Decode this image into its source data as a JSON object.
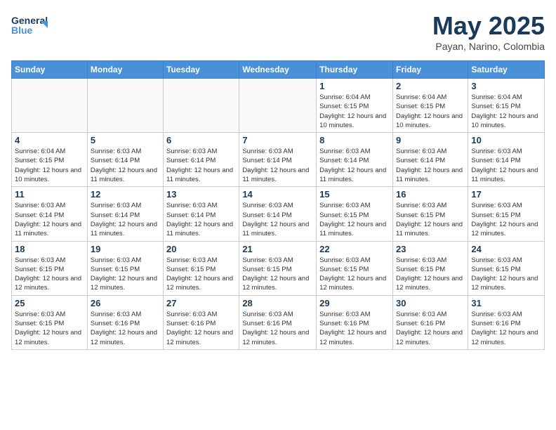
{
  "header": {
    "logo_general": "General",
    "logo_blue": "Blue",
    "month_year": "May 2025",
    "location": "Payan, Narino, Colombia"
  },
  "weekdays": [
    "Sunday",
    "Monday",
    "Tuesday",
    "Wednesday",
    "Thursday",
    "Friday",
    "Saturday"
  ],
  "weeks": [
    [
      {
        "day": "",
        "info": ""
      },
      {
        "day": "",
        "info": ""
      },
      {
        "day": "",
        "info": ""
      },
      {
        "day": "",
        "info": ""
      },
      {
        "day": "1",
        "info": "Sunrise: 6:04 AM\nSunset: 6:15 PM\nDaylight: 12 hours\nand 10 minutes."
      },
      {
        "day": "2",
        "info": "Sunrise: 6:04 AM\nSunset: 6:15 PM\nDaylight: 12 hours\nand 10 minutes."
      },
      {
        "day": "3",
        "info": "Sunrise: 6:04 AM\nSunset: 6:15 PM\nDaylight: 12 hours\nand 10 minutes."
      }
    ],
    [
      {
        "day": "4",
        "info": "Sunrise: 6:04 AM\nSunset: 6:15 PM\nDaylight: 12 hours\nand 10 minutes."
      },
      {
        "day": "5",
        "info": "Sunrise: 6:03 AM\nSunset: 6:14 PM\nDaylight: 12 hours\nand 11 minutes."
      },
      {
        "day": "6",
        "info": "Sunrise: 6:03 AM\nSunset: 6:14 PM\nDaylight: 12 hours\nand 11 minutes."
      },
      {
        "day": "7",
        "info": "Sunrise: 6:03 AM\nSunset: 6:14 PM\nDaylight: 12 hours\nand 11 minutes."
      },
      {
        "day": "8",
        "info": "Sunrise: 6:03 AM\nSunset: 6:14 PM\nDaylight: 12 hours\nand 11 minutes."
      },
      {
        "day": "9",
        "info": "Sunrise: 6:03 AM\nSunset: 6:14 PM\nDaylight: 12 hours\nand 11 minutes."
      },
      {
        "day": "10",
        "info": "Sunrise: 6:03 AM\nSunset: 6:14 PM\nDaylight: 12 hours\nand 11 minutes."
      }
    ],
    [
      {
        "day": "11",
        "info": "Sunrise: 6:03 AM\nSunset: 6:14 PM\nDaylight: 12 hours\nand 11 minutes."
      },
      {
        "day": "12",
        "info": "Sunrise: 6:03 AM\nSunset: 6:14 PM\nDaylight: 12 hours\nand 11 minutes."
      },
      {
        "day": "13",
        "info": "Sunrise: 6:03 AM\nSunset: 6:14 PM\nDaylight: 12 hours\nand 11 minutes."
      },
      {
        "day": "14",
        "info": "Sunrise: 6:03 AM\nSunset: 6:14 PM\nDaylight: 12 hours\nand 11 minutes."
      },
      {
        "day": "15",
        "info": "Sunrise: 6:03 AM\nSunset: 6:15 PM\nDaylight: 12 hours\nand 11 minutes."
      },
      {
        "day": "16",
        "info": "Sunrise: 6:03 AM\nSunset: 6:15 PM\nDaylight: 12 hours\nand 11 minutes."
      },
      {
        "day": "17",
        "info": "Sunrise: 6:03 AM\nSunset: 6:15 PM\nDaylight: 12 hours\nand 12 minutes."
      }
    ],
    [
      {
        "day": "18",
        "info": "Sunrise: 6:03 AM\nSunset: 6:15 PM\nDaylight: 12 hours\nand 12 minutes."
      },
      {
        "day": "19",
        "info": "Sunrise: 6:03 AM\nSunset: 6:15 PM\nDaylight: 12 hours\nand 12 minutes."
      },
      {
        "day": "20",
        "info": "Sunrise: 6:03 AM\nSunset: 6:15 PM\nDaylight: 12 hours\nand 12 minutes."
      },
      {
        "day": "21",
        "info": "Sunrise: 6:03 AM\nSunset: 6:15 PM\nDaylight: 12 hours\nand 12 minutes."
      },
      {
        "day": "22",
        "info": "Sunrise: 6:03 AM\nSunset: 6:15 PM\nDaylight: 12 hours\nand 12 minutes."
      },
      {
        "day": "23",
        "info": "Sunrise: 6:03 AM\nSunset: 6:15 PM\nDaylight: 12 hours\nand 12 minutes."
      },
      {
        "day": "24",
        "info": "Sunrise: 6:03 AM\nSunset: 6:15 PM\nDaylight: 12 hours\nand 12 minutes."
      }
    ],
    [
      {
        "day": "25",
        "info": "Sunrise: 6:03 AM\nSunset: 6:15 PM\nDaylight: 12 hours\nand 12 minutes."
      },
      {
        "day": "26",
        "info": "Sunrise: 6:03 AM\nSunset: 6:16 PM\nDaylight: 12 hours\nand 12 minutes."
      },
      {
        "day": "27",
        "info": "Sunrise: 6:03 AM\nSunset: 6:16 PM\nDaylight: 12 hours\nand 12 minutes."
      },
      {
        "day": "28",
        "info": "Sunrise: 6:03 AM\nSunset: 6:16 PM\nDaylight: 12 hours\nand 12 minutes."
      },
      {
        "day": "29",
        "info": "Sunrise: 6:03 AM\nSunset: 6:16 PM\nDaylight: 12 hours\nand 12 minutes."
      },
      {
        "day": "30",
        "info": "Sunrise: 6:03 AM\nSunset: 6:16 PM\nDaylight: 12 hours\nand 12 minutes."
      },
      {
        "day": "31",
        "info": "Sunrise: 6:03 AM\nSunset: 6:16 PM\nDaylight: 12 hours\nand 12 minutes."
      }
    ]
  ]
}
